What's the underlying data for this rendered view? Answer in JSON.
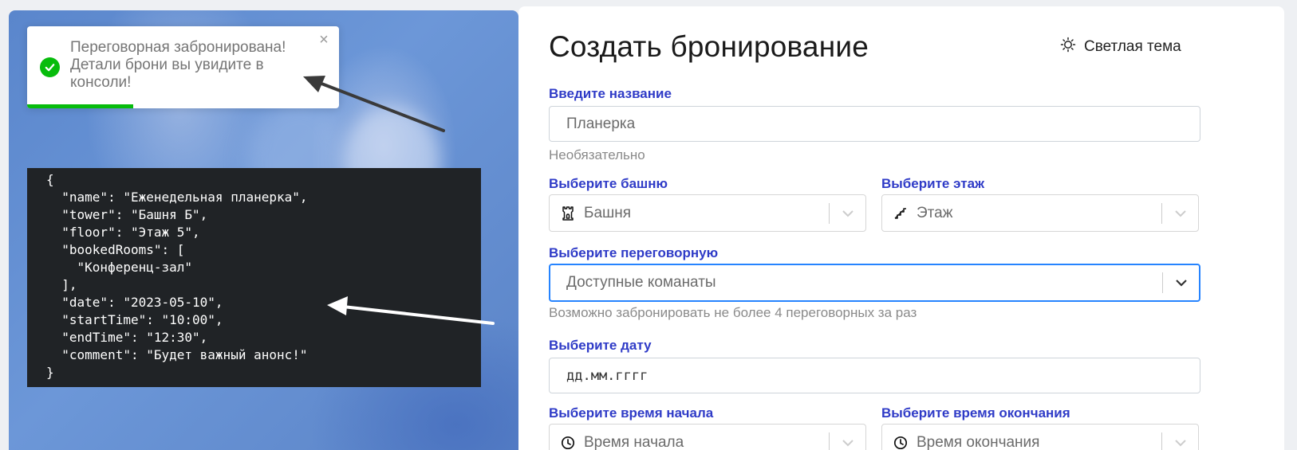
{
  "toast": {
    "line1": "Переговорная забронирована!",
    "line2": "Детали брони вы увидите в",
    "line3": "консоли!",
    "close": "×",
    "progress": 0.34,
    "status_color": "#07bc0c"
  },
  "console": {
    "json": "{\n  \"name\": \"Еженедельная планерка\",\n  \"tower\": \"Башня Б\",\n  \"floor\": \"Этаж 5\",\n  \"bookedRooms\": [\n    \"Конференц-зал\"\n  ],\n  \"date\": \"2023-05-10\",\n  \"startTime\": \"10:00\",\n  \"endTime\": \"12:30\",\n  \"comment\": \"Будет важный анонс!\"\n}"
  },
  "form": {
    "title": "Создать бронирование",
    "theme_label": "Светлая тема",
    "theme_icon": "sun-icon",
    "name_label": "Введите название",
    "name_placeholder": "Планерка",
    "name_hint": "Необязательно",
    "tower_label": "Выберите башню",
    "tower_placeholder": "Башня",
    "tower_icon": "tower-icon",
    "floor_label": "Выберите этаж",
    "floor_placeholder": "Этаж",
    "floor_icon": "stairs-icon",
    "room_label": "Выберите переговорную",
    "room_placeholder": "Доступные команаты",
    "room_hint": "Возможно забронировать не более 4 переговорных за раз",
    "date_label": "Выберите дату",
    "date_placeholder": "дд.мм.гггг",
    "start_label": "Выберите время начала",
    "start_placeholder": "Время начала",
    "end_label": "Выберите время окончания",
    "end_placeholder": "Время окончания",
    "clock_icon": "clock-icon",
    "accent_color": "#2f3bc7",
    "focus_color": "#2684ff"
  }
}
